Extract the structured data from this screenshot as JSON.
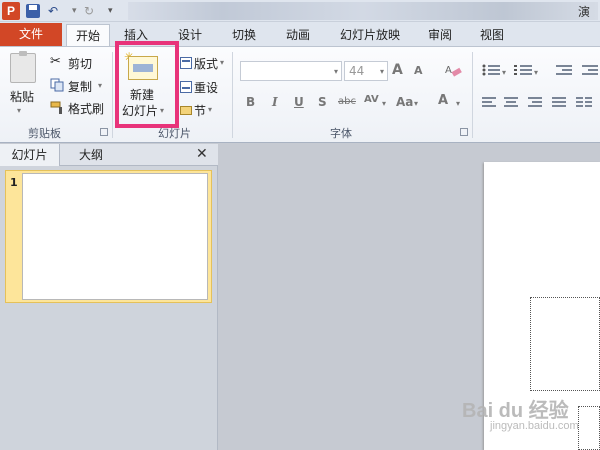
{
  "quick_access": {
    "logo_letter": "P",
    "undo_arrow": "▾",
    "custom_arrow": "▾"
  },
  "title": {
    "text": "演"
  },
  "tabs": {
    "file": "文件",
    "items": [
      "开始",
      "插入",
      "设计",
      "切换",
      "动画",
      "幻灯片放映",
      "审阅",
      "视图"
    ]
  },
  "clipboard": {
    "paste": "粘贴",
    "cut": "剪切",
    "copy": "复制",
    "format_painter": "格式刷",
    "group_label": "剪贴板"
  },
  "slides_group": {
    "new_slide_line1": "新建",
    "new_slide_line2": "幻灯片",
    "layout": "版式",
    "reset": "重设",
    "section": "节",
    "group_label": "幻灯片"
  },
  "font_group": {
    "font_name": "",
    "font_size": "44",
    "bold": "B",
    "italic": "I",
    "underline": "U",
    "shadow": "S",
    "strikethrough": "abc",
    "spacing": "AV",
    "case": "Aa",
    "color": "A",
    "grow": "A",
    "shrink": "A",
    "group_label": "字体"
  },
  "panel": {
    "tab_slides": "幻灯片",
    "tab_outline": "大纲",
    "close": "✕",
    "thumb_number": "1"
  },
  "watermark": {
    "main": "Bai du 经验",
    "sub": "jingyan.baidu.com"
  },
  "colors": {
    "file_tab": "#d24726",
    "highlight": "#e8337a",
    "selected_thumb": "#fde59a"
  }
}
